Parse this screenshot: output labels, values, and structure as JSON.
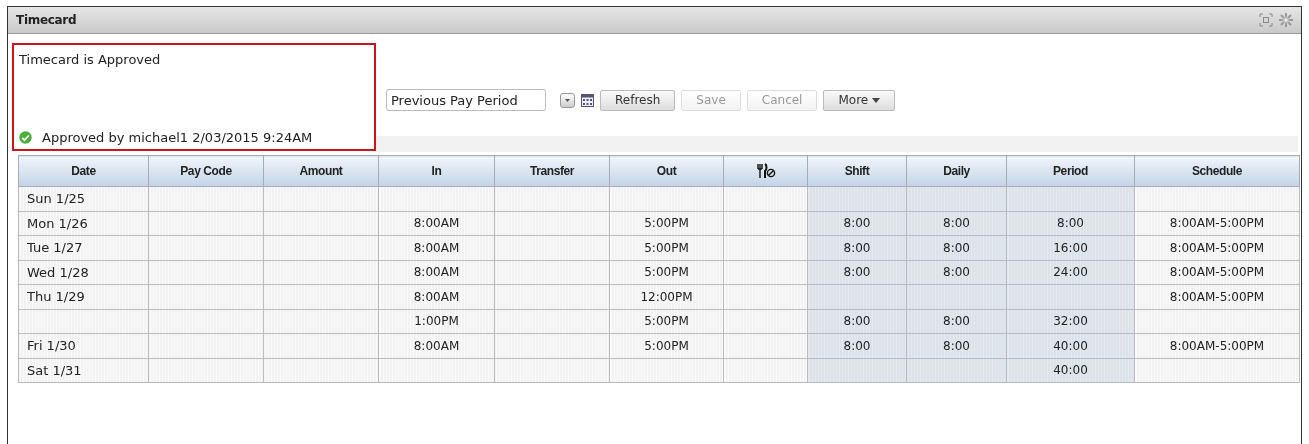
{
  "window": {
    "title": "Timecard"
  },
  "status": {
    "title": "Timecard is Approved",
    "approval": "Approved by michael1 2/03/2015 9:24AM",
    "approved": true
  },
  "toolbar": {
    "period": "Previous Pay Period",
    "buttons": [
      {
        "label": "Refresh",
        "disabled": false,
        "kind": "plain"
      },
      {
        "label": "Save",
        "disabled": true,
        "kind": "plain"
      },
      {
        "label": "Cancel",
        "disabled": true,
        "kind": "plain"
      },
      {
        "label": "More",
        "disabled": false,
        "kind": "menu"
      }
    ]
  },
  "table": {
    "columns": [
      {
        "label": "Date",
        "shaded": false
      },
      {
        "label": "Pay Code",
        "shaded": false
      },
      {
        "label": "Amount",
        "shaded": false
      },
      {
        "label": "In",
        "shaded": false
      },
      {
        "label": "Transfer",
        "shaded": false
      },
      {
        "label": "Out",
        "shaded": false
      },
      {
        "kind": "icon",
        "shaded": false
      },
      {
        "label": "Shift",
        "shaded": true
      },
      {
        "label": "Daily",
        "shaded": true
      },
      {
        "label": "Period",
        "shaded": true
      },
      {
        "label": "Schedule",
        "shaded": false
      }
    ],
    "rows": [
      {
        "cells": [
          "Sun 1/25",
          null,
          null,
          null,
          null,
          null,
          null,
          null,
          null,
          null,
          null
        ]
      },
      {
        "cells": [
          "Mon 1/26",
          null,
          null,
          "8:00AM",
          null,
          "5:00PM",
          null,
          "8:00",
          "8:00",
          "8:00",
          "8:00AM-5:00PM"
        ]
      },
      {
        "cells": [
          "Tue 1/27",
          null,
          null,
          "8:00AM",
          null,
          "5:00PM",
          null,
          "8:00",
          "8:00",
          "16:00",
          "8:00AM-5:00PM"
        ]
      },
      {
        "cells": [
          "Wed 1/28",
          null,
          null,
          "8:00AM",
          null,
          "5:00PM",
          null,
          "8:00",
          "8:00",
          "24:00",
          "8:00AM-5:00PM"
        ]
      },
      {
        "cells": [
          "Thu 1/29",
          null,
          null,
          "8:00AM",
          null,
          "12:00PM",
          null,
          null,
          null,
          null,
          "8:00AM-5:00PM"
        ]
      },
      {
        "cells": [
          null,
          null,
          null,
          "1:00PM",
          null,
          "5:00PM",
          null,
          "8:00",
          "8:00",
          "32:00",
          null
        ]
      },
      {
        "cells": [
          "Fri 1/30",
          null,
          null,
          "8:00AM",
          null,
          "5:00PM",
          null,
          "8:00",
          "8:00",
          "40:00",
          "8:00AM-5:00PM"
        ]
      },
      {
        "cells": [
          "Sat 1/31",
          null,
          null,
          null,
          null,
          null,
          null,
          null,
          null,
          "40:00",
          null
        ]
      }
    ]
  }
}
